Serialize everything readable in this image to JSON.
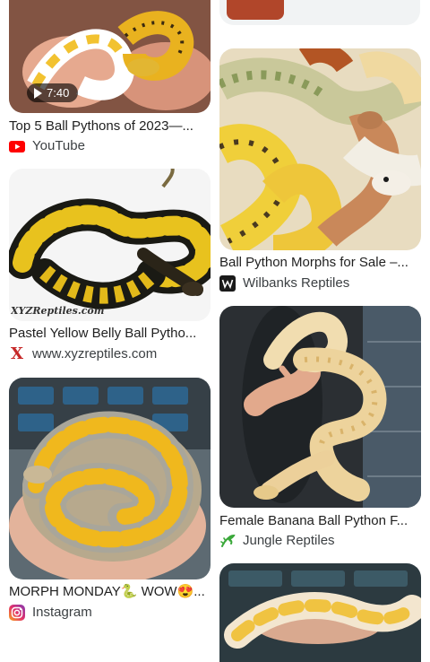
{
  "results": [
    {
      "title": "Top 5 Ball Pythons of 2023—...",
      "source": "YouTube",
      "source_icon": "youtube-icon",
      "duration": "7:40"
    },
    {
      "title": "Pastel Yellow Belly Ball Pytho...",
      "source": "www.xyzreptiles.com",
      "source_icon": "xyz-reptiles-icon",
      "watermark": "XYZReptiles.com"
    },
    {
      "title": "MORPH MONDAY🐍 WOW😍...",
      "source": "Instagram",
      "source_icon": "instagram-icon"
    },
    {
      "title": "Ball Python Morphs for Sale –...",
      "source": "Wilbanks Reptiles",
      "source_icon": "wilbanks-icon"
    },
    {
      "title": "Female Banana Ball Python F...",
      "source": "Jungle Reptiles",
      "source_icon": "jungle-reptiles-icon"
    }
  ],
  "colors": {
    "youtube_red": "#ff0000",
    "jungle_green": "#3aa83a"
  }
}
